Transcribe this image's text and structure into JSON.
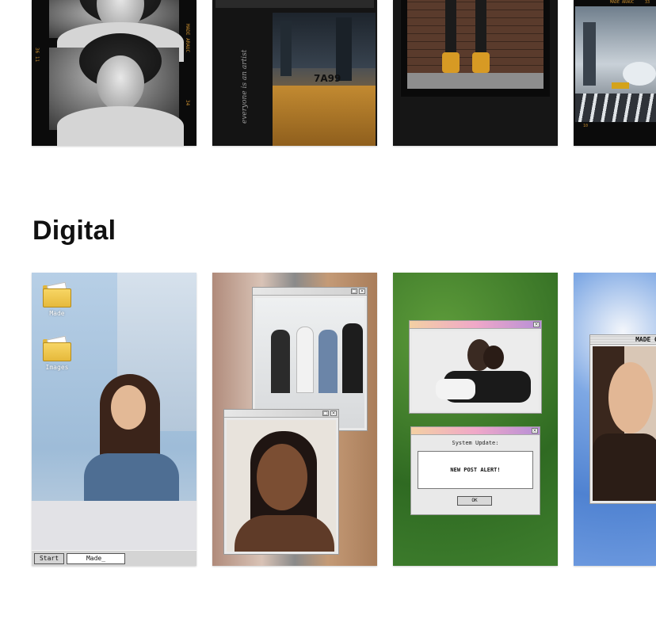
{
  "sections": {
    "digital_title": "Digital"
  },
  "film": {
    "card1": {
      "edge_top": "MADE ARAUC",
      "edge_mid": "34",
      "edge_side": "36 11"
    },
    "card2": {
      "plate": "7A99",
      "script": "everyone is an artist"
    },
    "card4": {
      "edge_top": "MADE ARAUC",
      "edge_num": "33",
      "edge_bottom": "10"
    }
  },
  "digital": {
    "card1": {
      "folders": [
        {
          "label": "Made"
        },
        {
          "label": "Images"
        }
      ],
      "taskbar": {
        "start": "Start",
        "field": "Made_"
      }
    },
    "card3": {
      "dialog_title": "System Update:",
      "dialog_message": "NEW POST ALERT!",
      "ok_label": "OK"
    },
    "card4": {
      "window_label": "MADE O"
    }
  },
  "icons": {
    "maximize": "□",
    "close": "×"
  },
  "colors": {
    "film_edge": "#c58b2e",
    "folder": "#e6b93b",
    "sky": "#5d8fd6",
    "grass": "#3e7a2a"
  }
}
